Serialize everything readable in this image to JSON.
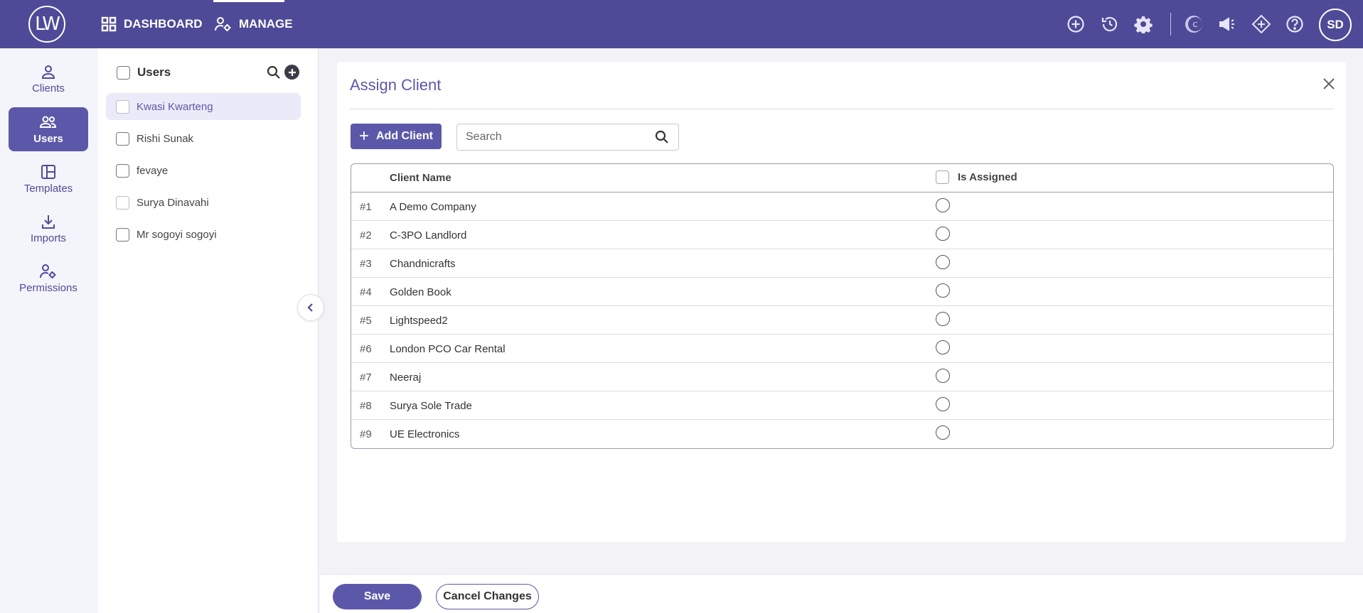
{
  "app": {
    "logo_text": "LW",
    "user_initials": "SD"
  },
  "nav": {
    "dashboard_label": "DASHBOARD",
    "manage_label": "MANAGE"
  },
  "top_icons": [
    "add-circle-icon",
    "history-icon",
    "gear-icon",
    "c-brand-icon",
    "megaphone-icon",
    "diamond-icon",
    "help-icon"
  ],
  "rail": {
    "items": [
      {
        "label": "Clients",
        "icon": "person-icon"
      },
      {
        "label": "Users",
        "icon": "users-icon",
        "active": true
      },
      {
        "label": "Templates",
        "icon": "layout-icon"
      },
      {
        "label": "Imports",
        "icon": "download-icon"
      },
      {
        "label": "Permissions",
        "icon": "user-gear-icon"
      }
    ]
  },
  "users_panel": {
    "title": "Users",
    "users": [
      {
        "name": "Kwasi Kwarteng",
        "selected": true
      },
      {
        "name": "Rishi Sunak"
      },
      {
        "name": "fevaye"
      },
      {
        "name": "Surya Dinavahi"
      },
      {
        "name": "Mr sogoyi sogoyi"
      }
    ]
  },
  "assign": {
    "title": "Assign Client",
    "add_label": "Add Client",
    "search_placeholder": "Search",
    "col_name": "Client Name",
    "col_assigned": "Is Assigned",
    "rows": [
      {
        "num": "#1",
        "name": "A Demo Company"
      },
      {
        "num": "#2",
        "name": "C-3PO Landlord"
      },
      {
        "num": "#3",
        "name": "Chandnicrafts"
      },
      {
        "num": "#4",
        "name": "Golden Book"
      },
      {
        "num": "#5",
        "name": "Lightspeed2"
      },
      {
        "num": "#6",
        "name": "London PCO Car Rental"
      },
      {
        "num": "#7",
        "name": "Neeraj"
      },
      {
        "num": "#8",
        "name": "Surya Sole Trade"
      },
      {
        "num": "#9",
        "name": "UE Electronics"
      }
    ]
  },
  "footer": {
    "save_label": "Save",
    "cancel_label": "Cancel Changes"
  },
  "colors": {
    "brand": "#4e4a97",
    "accent": "#5c58a9"
  }
}
